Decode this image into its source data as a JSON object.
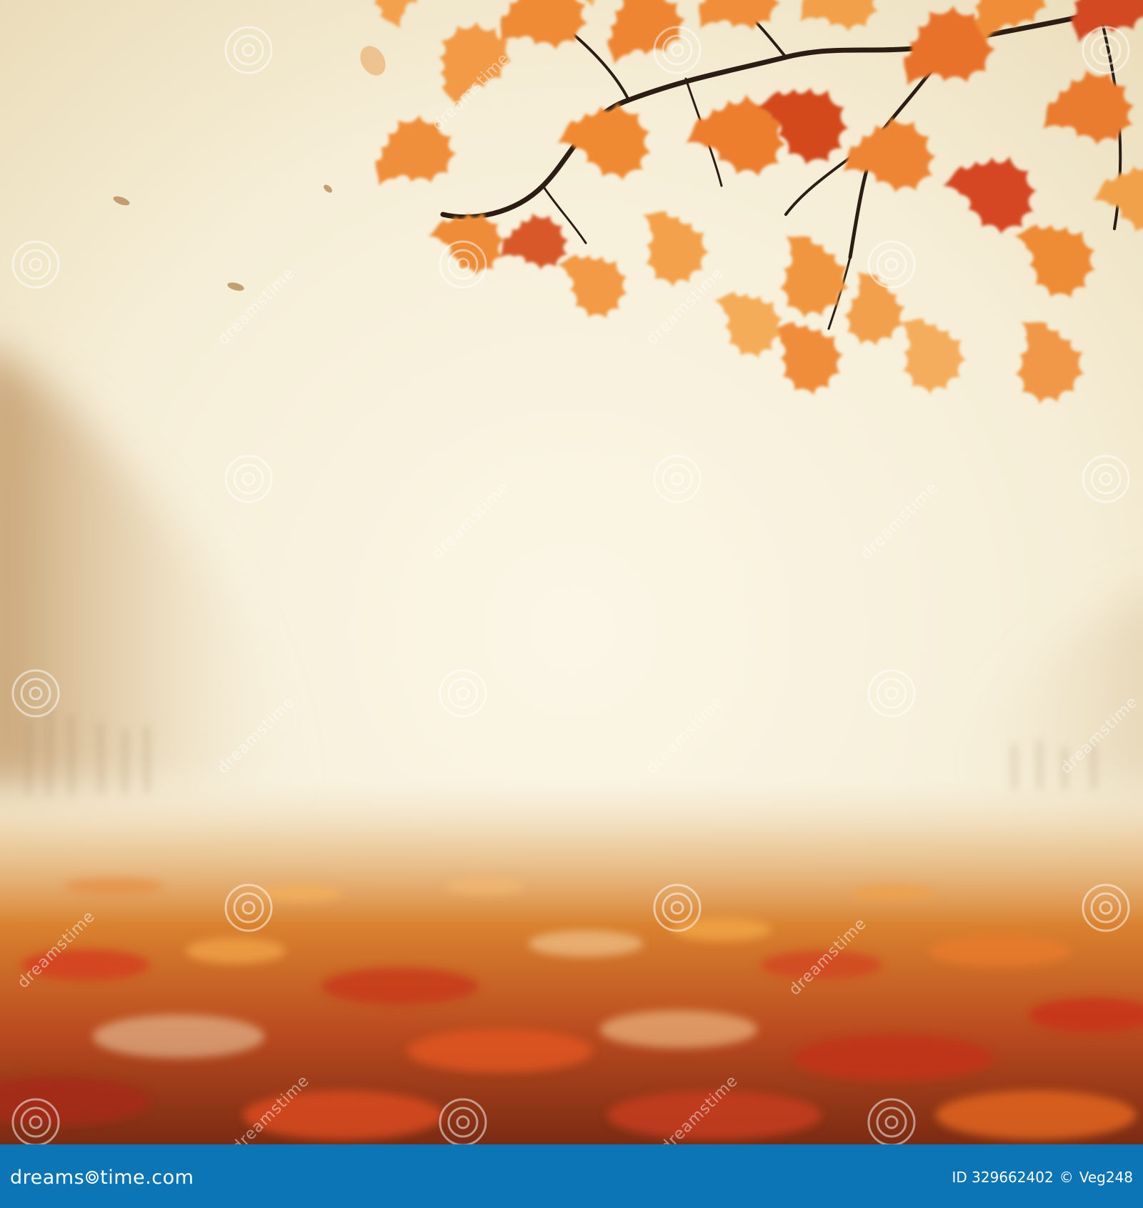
{
  "footer": {
    "brand_prefix": "dreams",
    "brand_suffix": "time.com",
    "image_id_label": "ID 329662402",
    "copyright_symbol": "©",
    "author": "Veg248"
  },
  "watermark": {
    "text": "dreamstime"
  },
  "colors": {
    "sky": "#f7f0dc",
    "fog": "#efe3c8",
    "leaf_orange": "#ec8a34",
    "leaf_red": "#cf3b1e",
    "branch": "#2b1d14",
    "footer_bar": "#0c75b5"
  }
}
